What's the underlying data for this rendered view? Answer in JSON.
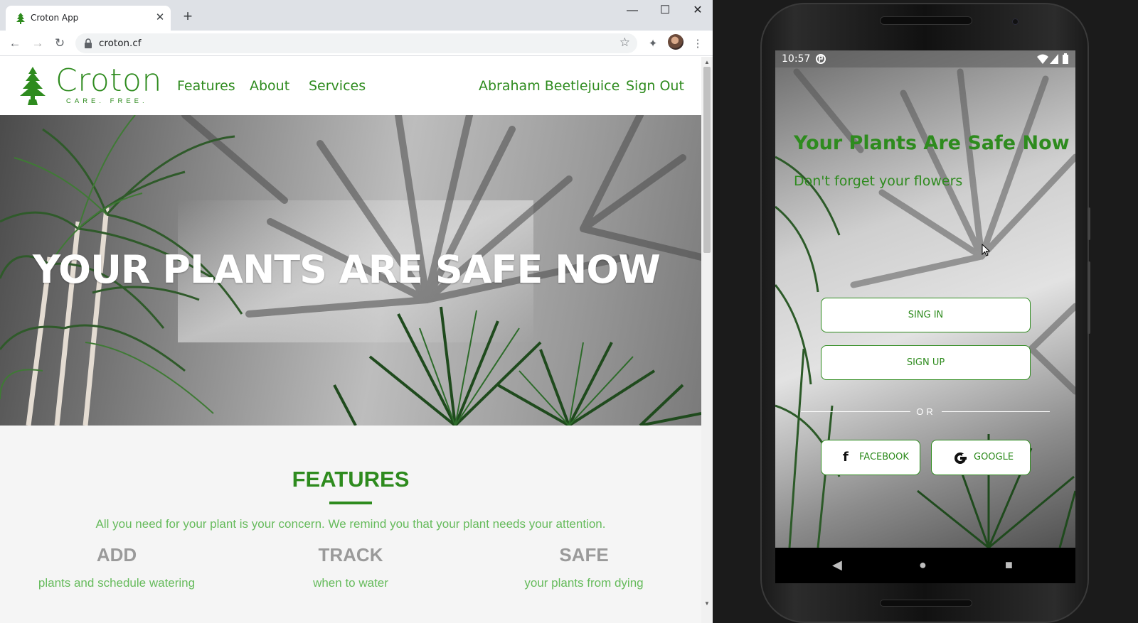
{
  "browser": {
    "tab_title": "Croton App",
    "url": "croton.cf"
  },
  "site": {
    "logo_name": "Croton",
    "logo_tagline": "CARE. FREE.",
    "nav": [
      "Features",
      "About",
      "Services"
    ],
    "user_name": "Abraham Beetlejuice",
    "sign_out": "Sign Out",
    "hero_title": "YOUR PLANTS ARE SAFE NOW",
    "features_title": "FEATURES",
    "features_subtitle": "All you need for your plant is your concern. We remind you that your plant needs your attention.",
    "features": [
      {
        "heading": "ADD",
        "text": "plants and schedule watering"
      },
      {
        "heading": "TRACK",
        "text": "when to water"
      },
      {
        "heading": "SAFE",
        "text": "your plants from dying"
      }
    ],
    "brand_color": "#2e8b1e",
    "light_green": "#66bb5c"
  },
  "phone": {
    "time": "10:57",
    "title": "Your Plants Are Safe Now",
    "subtitle": "Don't forget your flowers",
    "sign_in": "SING IN",
    "sign_up": "SIGN UP",
    "or": "OR",
    "facebook": "FACEBOOK",
    "google": "GOOGLE"
  }
}
